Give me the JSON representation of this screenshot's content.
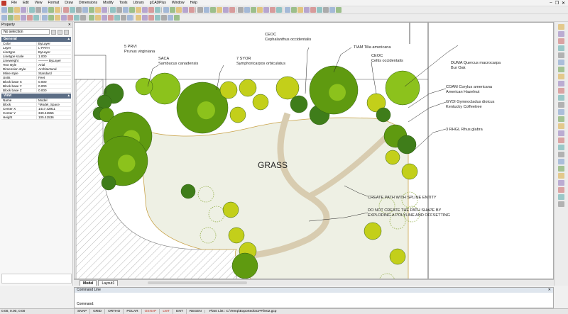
{
  "menu": [
    "File",
    "Edit",
    "View",
    "Format",
    "Draw",
    "Dimensions",
    "Modify",
    "Tools",
    "Library",
    "gCADPlus",
    "Window",
    "Help"
  ],
  "window_controls": [
    "–",
    "❐",
    "✕"
  ],
  "properties": {
    "title": "Property",
    "selection": "No selection",
    "general": {
      "title": "General",
      "rows": [
        {
          "k": "Color",
          "v": "ByLayer"
        },
        {
          "k": "Layer",
          "v": "L-PATH"
        },
        {
          "k": "Linetype",
          "v": "ByLayer"
        },
        {
          "k": "Linetype scale",
          "v": "1.000"
        },
        {
          "k": "Lineweight",
          "v": "——— ByLayer"
        },
        {
          "k": "Text style",
          "v": "Arial"
        },
        {
          "k": "Dimension style",
          "v": "Architectural"
        },
        {
          "k": "Mline style",
          "v": "Standard"
        },
        {
          "k": "Units",
          "v": "Feet"
        },
        {
          "k": "Block base X",
          "v": "0.000"
        },
        {
          "k": "Block base Y",
          "v": "0.000"
        },
        {
          "k": "Block base Z",
          "v": "0.000"
        }
      ]
    },
    "view": {
      "title": "View",
      "rows": [
        {
          "k": "Name",
          "v": "Model"
        },
        {
          "k": "Block",
          "v": "*Model_Space"
        },
        {
          "k": "Center X",
          "v": "1417.42911"
        },
        {
          "k": "Center Y",
          "v": "349.41555"
        },
        {
          "k": "Height",
          "v": "105.41536"
        }
      ]
    }
  },
  "drawing": {
    "grass_label": "GRASS",
    "annotations": [
      {
        "id": "prvi",
        "lines": [
          "5 PRVI",
          "Prunus virginiana"
        ]
      },
      {
        "id": "saca",
        "lines": [
          "SACA",
          "Sambucus canadensis"
        ]
      },
      {
        "id": "syor",
        "lines": [
          "7 SYOR",
          "Symphoricarpos orbiculatus"
        ]
      },
      {
        "id": "ceoc1",
        "lines": [
          "CEOC",
          "Cephalanthus occidentalis"
        ]
      },
      {
        "id": "tiam",
        "lines": [
          "TIAM Tilia americana"
        ]
      },
      {
        "id": "ceoc2",
        "lines": [
          "CEOC",
          "Celtis occidentalis"
        ]
      },
      {
        "id": "duma",
        "lines": [
          "DUMA Quercus macrocarpa",
          "Bur Oak"
        ]
      },
      {
        "id": "coam",
        "lines": [
          "COAM Corylus americana",
          "American Hazelnut"
        ]
      },
      {
        "id": "gydi",
        "lines": [
          "GYDI Gymnocladus dioicus",
          "Kentucky Coffeetree"
        ]
      },
      {
        "id": "rhgl",
        "lines": [
          "3 RHGL Rhus glabra"
        ]
      },
      {
        "id": "path1",
        "lines": [
          "CREATE PATH WITH SPLINE ENTITY"
        ]
      },
      {
        "id": "path2",
        "lines": [
          "DO NOT CREATE THE PATH SHAPE BY",
          "EXPLODING A POLYLINE AND OFFSETTING"
        ]
      }
    ]
  },
  "tabs": [
    "Model",
    "Layout1"
  ],
  "command": {
    "title": "Command Line",
    "prompt": "Command:"
  },
  "status": {
    "coords": "0.00, 0.00, 0.00",
    "buttons": [
      {
        "label": "SNAP",
        "on": false
      },
      {
        "label": "GRID",
        "on": false
      },
      {
        "label": "ORTHO",
        "on": false
      },
      {
        "label": "POLAR",
        "on": false
      },
      {
        "label": "OSNAP",
        "on": true
      },
      {
        "label": "LWT",
        "on": true
      },
      {
        "label": "ENT",
        "on": false
      },
      {
        "label": "REGEN",
        "on": false
      }
    ],
    "info": "Plant List : C:\\Temp\\ExportedGCPFile02.gcp"
  },
  "colors": {
    "tree_dark": "#3f7d1a",
    "tree_mid": "#5f9a10",
    "tree_light": "#8cc21c",
    "shrub_yellow": "#c3cf1a",
    "grass": "#eef0e4",
    "path": "#e7dcc4",
    "accent_red": "#c0392b"
  }
}
